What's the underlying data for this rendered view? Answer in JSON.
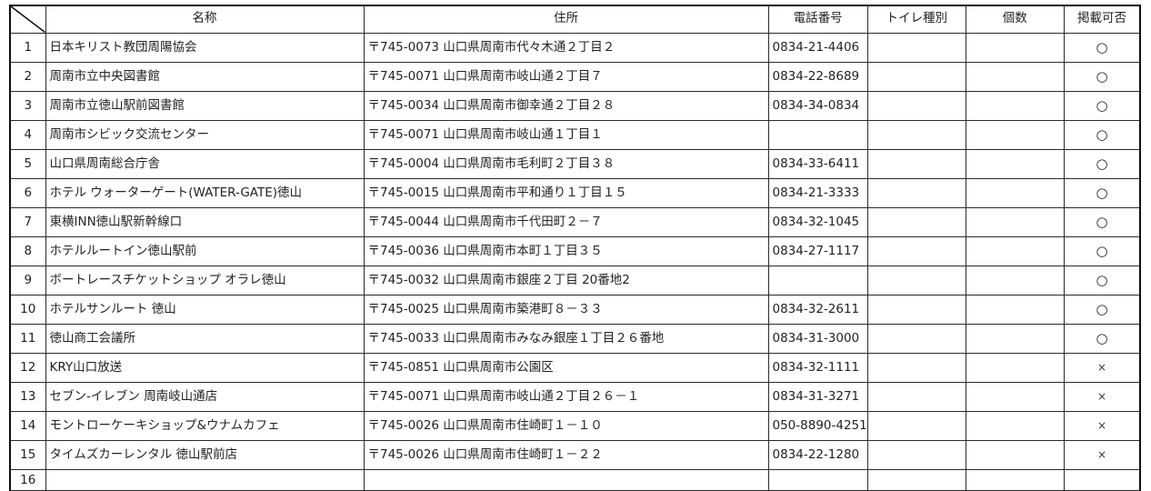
{
  "headers": {
    "name": "名称",
    "address": "住所",
    "phone": "電話番号",
    "toilet_type": "トイレ種別",
    "count": "個数",
    "publish": "掲載可否"
  },
  "marks": {
    "ok": "○",
    "ng": "×"
  },
  "rows": [
    {
      "no": "1",
      "name": "日本キリスト教団周陽協会",
      "address": "〒745-0073 山口県周南市代々木通２丁目２",
      "phone": "0834-21-4406",
      "toilet_type": "",
      "count": "",
      "publish": "○"
    },
    {
      "no": "2",
      "name": "周南市立中央図書館",
      "address": "〒745-0071 山口県周南市岐山通２丁目７",
      "phone": "0834-22-8689",
      "toilet_type": "",
      "count": "",
      "publish": "○"
    },
    {
      "no": "3",
      "name": "周南市立徳山駅前図書館",
      "address": "〒745-0034 山口県周南市御幸通２丁目２８",
      "phone": "0834-34-0834",
      "toilet_type": "",
      "count": "",
      "publish": "○"
    },
    {
      "no": "4",
      "name": "周南市シビック交流センター",
      "address": "〒745-0071 山口県周南市岐山通１丁目１",
      "phone": "",
      "toilet_type": "",
      "count": "",
      "publish": "○"
    },
    {
      "no": "5",
      "name": "山口県周南総合庁舎",
      "address": "〒745-0004 山口県周南市毛利町２丁目３８",
      "phone": "0834-33-6411",
      "toilet_type": "",
      "count": "",
      "publish": "○"
    },
    {
      "no": "6",
      "name": "ホテル ウォーターゲート(WATER-GATE)徳山",
      "address": "〒745-0015 山口県周南市平和通り１丁目１５",
      "phone": "0834-21-3333",
      "toilet_type": "",
      "count": "",
      "publish": "○"
    },
    {
      "no": "7",
      "name": "東横INN徳山駅新幹線口",
      "address": "〒745-0044 山口県周南市千代田町２－７",
      "phone": "0834-32-1045",
      "toilet_type": "",
      "count": "",
      "publish": "○"
    },
    {
      "no": "8",
      "name": "ホテルルートイン徳山駅前",
      "address": "〒745-0036 山口県周南市本町１丁目３５",
      "phone": "0834-27-1117",
      "toilet_type": "",
      "count": "",
      "publish": "○"
    },
    {
      "no": "9",
      "name": "ボートレースチケットショップ オラレ徳山",
      "address": "〒745-0032 山口県周南市銀座２丁目 20番地2",
      "phone": "",
      "toilet_type": "",
      "count": "",
      "publish": "○"
    },
    {
      "no": "10",
      "name": "ホテルサンルート 徳山",
      "address": "〒745-0025 山口県周南市築港町８－３３",
      "phone": "0834-32-2611",
      "toilet_type": "",
      "count": "",
      "publish": "○"
    },
    {
      "no": "11",
      "name": "徳山商工会議所",
      "address": "〒745-0033 山口県周南市みなみ銀座１丁目２６番地",
      "phone": "0834-31-3000",
      "toilet_type": "",
      "count": "",
      "publish": "○"
    },
    {
      "no": "12",
      "name": "KRY山口放送",
      "address": "〒745-0851 山口県周南市公園区",
      "phone": "0834-32-1111",
      "toilet_type": "",
      "count": "",
      "publish": "×"
    },
    {
      "no": "13",
      "name": "セブン-イレブン 周南岐山通店",
      "address": "〒745-0071 山口県周南市岐山通２丁目２６－１",
      "phone": "0834-31-3271",
      "toilet_type": "",
      "count": "",
      "publish": "×"
    },
    {
      "no": "14",
      "name": "モントローケーキショップ&ウナムカフェ",
      "address": "〒745-0026 山口県周南市住崎町１－１０",
      "phone": "050-8890-4251",
      "toilet_type": "",
      "count": "",
      "publish": "×"
    },
    {
      "no": "15",
      "name": "タイムズカーレンタル 徳山駅前店",
      "address": "〒745-0026 山口県周南市住崎町１－２２",
      "phone": "0834-22-1280",
      "toilet_type": "",
      "count": "",
      "publish": "×"
    },
    {
      "no": "16",
      "name": "",
      "address": "",
      "phone": "",
      "toilet_type": "",
      "count": "",
      "publish": ""
    }
  ]
}
